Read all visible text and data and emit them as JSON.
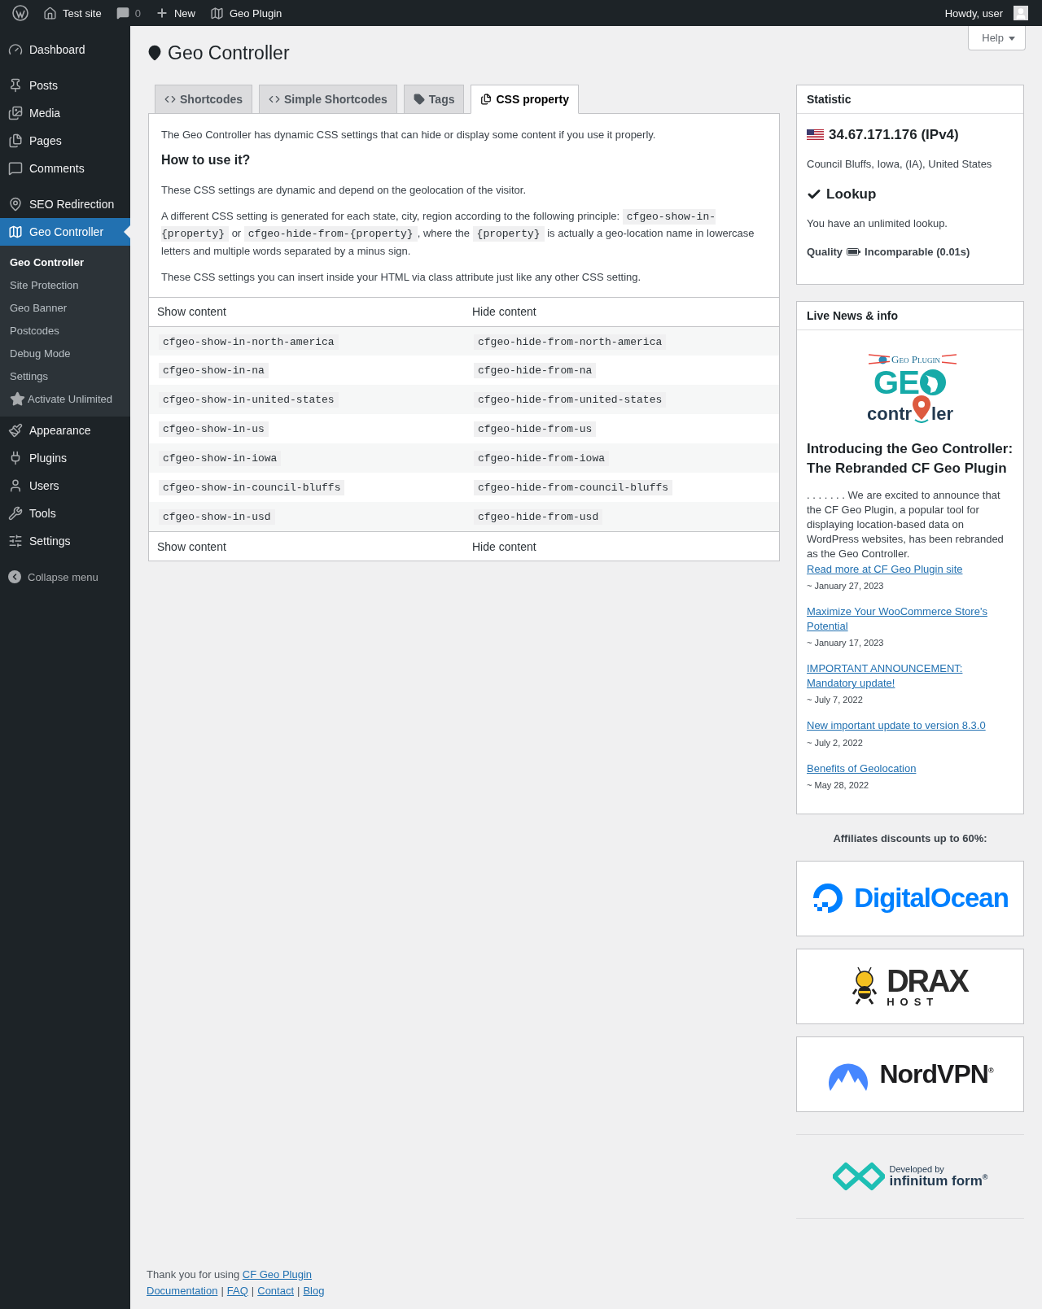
{
  "admin_bar": {
    "site": "Test site",
    "comments": "0",
    "new": "New",
    "plugin": "Geo Plugin",
    "greeting": "Howdy, user"
  },
  "sidebar": {
    "groups": [
      [
        {
          "label": "Dashboard",
          "selected": false
        }
      ],
      [
        {
          "label": "Posts",
          "selected": false
        },
        {
          "label": "Media",
          "selected": false
        },
        {
          "label": "Pages",
          "selected": false
        },
        {
          "label": "Comments",
          "selected": false
        }
      ],
      [
        {
          "label": "SEO Redirection",
          "selected": false
        },
        {
          "label": "Geo Controller",
          "selected": true,
          "children": [
            {
              "label": "Geo Controller",
              "selected": true
            },
            {
              "label": "Site Protection",
              "selected": false
            },
            {
              "label": "Geo Banner",
              "selected": false
            },
            {
              "label": "Postcodes",
              "selected": false
            },
            {
              "label": "Debug Mode",
              "selected": false
            },
            {
              "label": "Settings",
              "selected": false
            },
            {
              "label": "Activate Unlimited",
              "selected": false,
              "kind": "star"
            }
          ]
        },
        {
          "label": "Appearance",
          "selected": false
        },
        {
          "label": "Plugins",
          "selected": false
        },
        {
          "label": "Users",
          "selected": false
        },
        {
          "label": "Tools",
          "selected": false
        },
        {
          "label": "Settings",
          "selected": false
        }
      ]
    ],
    "collapse": "Collapse menu"
  },
  "help_button": "Help",
  "page_title": "Geo Controller",
  "tabs": [
    {
      "label": "Shortcodes",
      "selected": false
    },
    {
      "label": "Simple Shortcodes",
      "selected": false
    },
    {
      "label": "Tags",
      "selected": false
    },
    {
      "label": "CSS property",
      "selected": true
    }
  ],
  "intro": "The Geo Controller has dynamic CSS settings that can hide or display some content if you use it properly.",
  "how_to_title": "How to use it?",
  "paragraphs": [
    [
      {
        "kind": "text",
        "text": "These CSS settings are dynamic and depend on the geolocation of the visitor."
      }
    ],
    [
      {
        "kind": "text",
        "text": "A different CSS setting is generated for each state, city, region according to the following principle: "
      },
      {
        "kind": "code",
        "text": "cfgeo-show-in-{property}"
      },
      {
        "kind": "text",
        "text": " or "
      },
      {
        "kind": "code",
        "text": "cfgeo-hide-from-{property}"
      },
      {
        "kind": "text",
        "text": ", where the "
      },
      {
        "kind": "code",
        "text": "{property}"
      },
      {
        "kind": "text",
        "text": " is actually a geo-location name in lowercase letters and multiple words separated by a minus sign."
      }
    ],
    [
      {
        "kind": "text",
        "text": "These CSS settings you can insert inside your HTML via class attribute just like any other CSS setting."
      }
    ]
  ],
  "table": {
    "columns": [
      "Show content",
      "Hide content"
    ],
    "rows": [
      [
        "cfgeo-show-in-north-america",
        "cfgeo-hide-from-north-america"
      ],
      [
        "cfgeo-show-in-na",
        "cfgeo-hide-from-na"
      ],
      [
        "cfgeo-show-in-united-states",
        "cfgeo-hide-from-united-states"
      ],
      [
        "cfgeo-show-in-us",
        "cfgeo-hide-from-us"
      ],
      [
        "cfgeo-show-in-iowa",
        "cfgeo-hide-from-iowa"
      ],
      [
        "cfgeo-show-in-council-bluffs",
        "cfgeo-hide-from-council-bluffs"
      ],
      [
        "cfgeo-show-in-usd",
        "cfgeo-hide-from-usd"
      ]
    ],
    "footer_columns": [
      "Show content",
      "Hide content"
    ]
  },
  "statistic": {
    "title": "Statistic",
    "ip": "34.67.171.176 (IPv4)",
    "location": "Council Bluffs, Iowa, (IA), United States",
    "lookup_title": "Lookup",
    "lookup_text": "You have an unlimited lookup.",
    "quality_label": "Quality",
    "quality_value": "Incomparable (0.01s)"
  },
  "news": {
    "title": "Live News & info",
    "logo": {
      "old_name": "Geo Plugin",
      "top": "GE",
      "bottom_left": "contr",
      "bottom_right": "ler"
    },
    "featured": {
      "title": "Introducing the Geo Controller: The Rebranded CF Geo Plugin",
      "body": ". . . . . . . We are excited to announce that the CF Geo Plugin, a popular tool for displaying location-based data on WordPress websites, has been rebranded as the Geo Controller.",
      "link": "Read more at CF Geo Plugin site",
      "date": "~ January 27, 2023"
    },
    "items": [
      {
        "link": "Maximize Your WooCommerce Store's Potential",
        "date": "~ January 17, 2023"
      },
      {
        "link": "IMPORTANT ANNOUNCEMENT: Mandatory update!",
        "date": "~ July 7, 2022"
      },
      {
        "link": "New important update to version 8.3.0",
        "date": "~ July 2, 2022"
      },
      {
        "link": "Benefits of Geolocation",
        "date": "~ May 28, 2022"
      }
    ]
  },
  "affiliates": {
    "title": "Affiliates discounts up to 60%:",
    "items": [
      {
        "kind": "ocean",
        "name": "DigitalOcean"
      },
      {
        "kind": "drax",
        "name": "DRAX",
        "sub": "HOST"
      },
      {
        "kind": "nord",
        "name": "NordVPN",
        "mark": "®"
      }
    ]
  },
  "developer": {
    "caption": "Developed by",
    "name": "infinitum form",
    "mark": "®"
  },
  "footer": {
    "thanks": "Thank you for using ",
    "thanks_link": "CF Geo Plugin",
    "links": [
      "Documentation",
      "FAQ",
      "Contact",
      "Blog"
    ],
    "separator": "|"
  }
}
